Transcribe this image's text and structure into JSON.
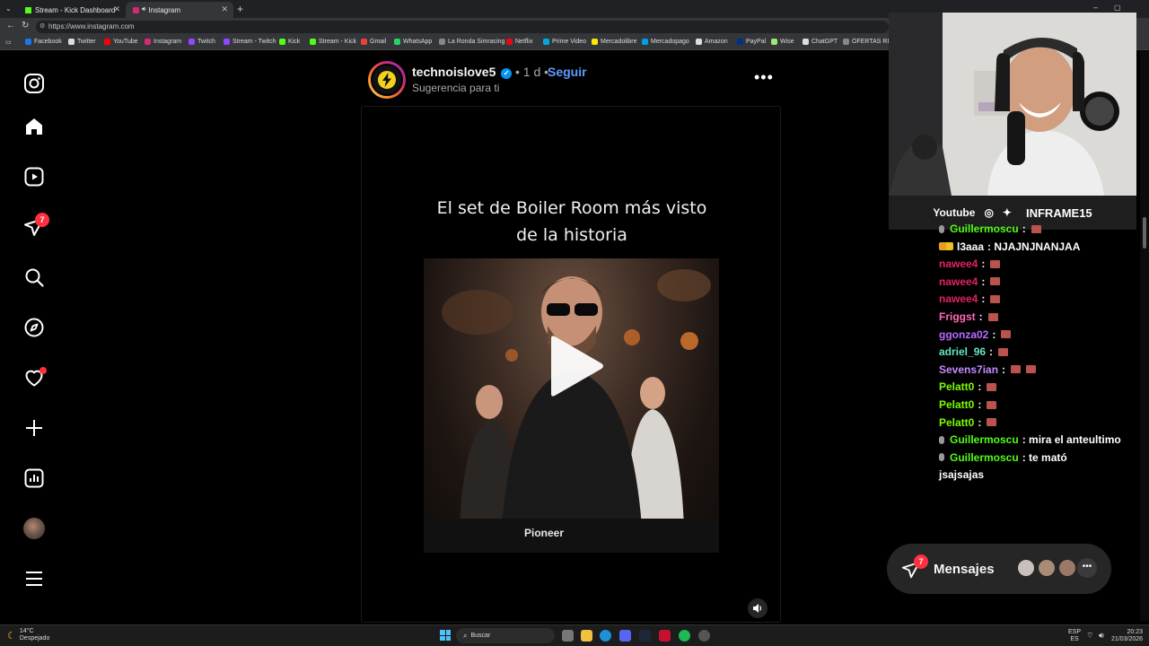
{
  "browser": {
    "tabs": [
      {
        "title": "Stream - Kick Dashboard",
        "active": false
      },
      {
        "title": "Instagram",
        "active": true
      }
    ],
    "url": "https://www.instagram.com",
    "bookmarks": [
      "Facebook",
      "Twitter",
      "YouTube",
      "Instagram",
      "Twitch",
      "Stream - Twitch",
      "Kick",
      "Stream - Kick",
      "Gmail",
      "WhatsApp",
      "La Ronda Simracing",
      "Netflix",
      "Prime Video",
      "Mercadolibre",
      "Mercadopago",
      "Amazon",
      "PayPal",
      "Wise",
      "ChatGPT",
      "OFERTAS RIKY S"
    ]
  },
  "sidebar": {
    "notifications_count": "7",
    "icons": [
      "instagram-logo-icon",
      "home-icon",
      "reels-icon",
      "messages-icon",
      "search-icon",
      "explore-icon",
      "notifications-heart-icon",
      "create-plus-icon",
      "dashboard-icon",
      "profile-avatar",
      "menu-icon"
    ]
  },
  "post": {
    "username": "technoislove5",
    "verified": true,
    "time": "• 1 d •",
    "follow_label": "Seguir",
    "subtitle": "Sugerencia para ti",
    "more_label": "•••",
    "video_caption_line1": "El set de Boiler Room más visto",
    "video_caption_line2": "de la historia",
    "brand_text": "Pioneer"
  },
  "stream_overlay": {
    "social_youtube": "Youtube",
    "handle": "INFRAME15"
  },
  "chat": [
    {
      "user": "Guillermoscu",
      "text": ":",
      "emotes": 1,
      "color": "#53fc18",
      "mic": true
    },
    {
      "user": "l3aaa",
      "text": ": NJAJNJNANJAA",
      "emotes": 0,
      "color": "#ffffff",
      "badges": true
    },
    {
      "user": "nawee4",
      "text": ":",
      "emotes": 1,
      "color": "#e0245e"
    },
    {
      "user": "nawee4",
      "text": ":",
      "emotes": 1,
      "color": "#e0245e"
    },
    {
      "user": "nawee4",
      "text": ":",
      "emotes": 1,
      "color": "#e0245e"
    },
    {
      "user": "Friggst",
      "text": ":",
      "emotes": 1,
      "color": "#ff69b4"
    },
    {
      "user": "ggonza02",
      "text": ":",
      "emotes": 1,
      "color": "#b86bff"
    },
    {
      "user": "adriel_96",
      "text": ":",
      "emotes": 1,
      "color": "#63e6be"
    },
    {
      "user": "Sevens7ian",
      "text": ":",
      "emotes": 2,
      "color": "#c48bff"
    },
    {
      "user": "Pelatt0",
      "text": ":",
      "emotes": 1,
      "color": "#7cfc00"
    },
    {
      "user": "Pelatt0",
      "text": ":",
      "emotes": 1,
      "color": "#7cfc00"
    },
    {
      "user": "Pelatt0",
      "text": ":",
      "emotes": 1,
      "color": "#7cfc00"
    },
    {
      "user": "Guillermoscu",
      "text": ": mira el anteultimo",
      "emotes": 0,
      "color": "#53fc18",
      "mic": true
    },
    {
      "user": "Guillermoscu",
      "text": ": te mató",
      "emotes": 0,
      "color": "#53fc18",
      "mic": true
    },
    {
      "user": "",
      "text": "jsajsajas",
      "emotes": 0,
      "color": "#ffffff"
    }
  ],
  "messages_widget": {
    "label": "Mensajes",
    "count": "7"
  },
  "taskbar": {
    "weather_temp": "14°C",
    "weather_desc": "Despejado",
    "search_label": "Buscar",
    "lang": "ESP",
    "lang_sub": "ES",
    "time": "20:23",
    "date": "21/03/2026"
  },
  "colors": {
    "accent_blue": "#5e9bff",
    "kick_green": "#53fc18",
    "badge_red": "#ff3040"
  }
}
